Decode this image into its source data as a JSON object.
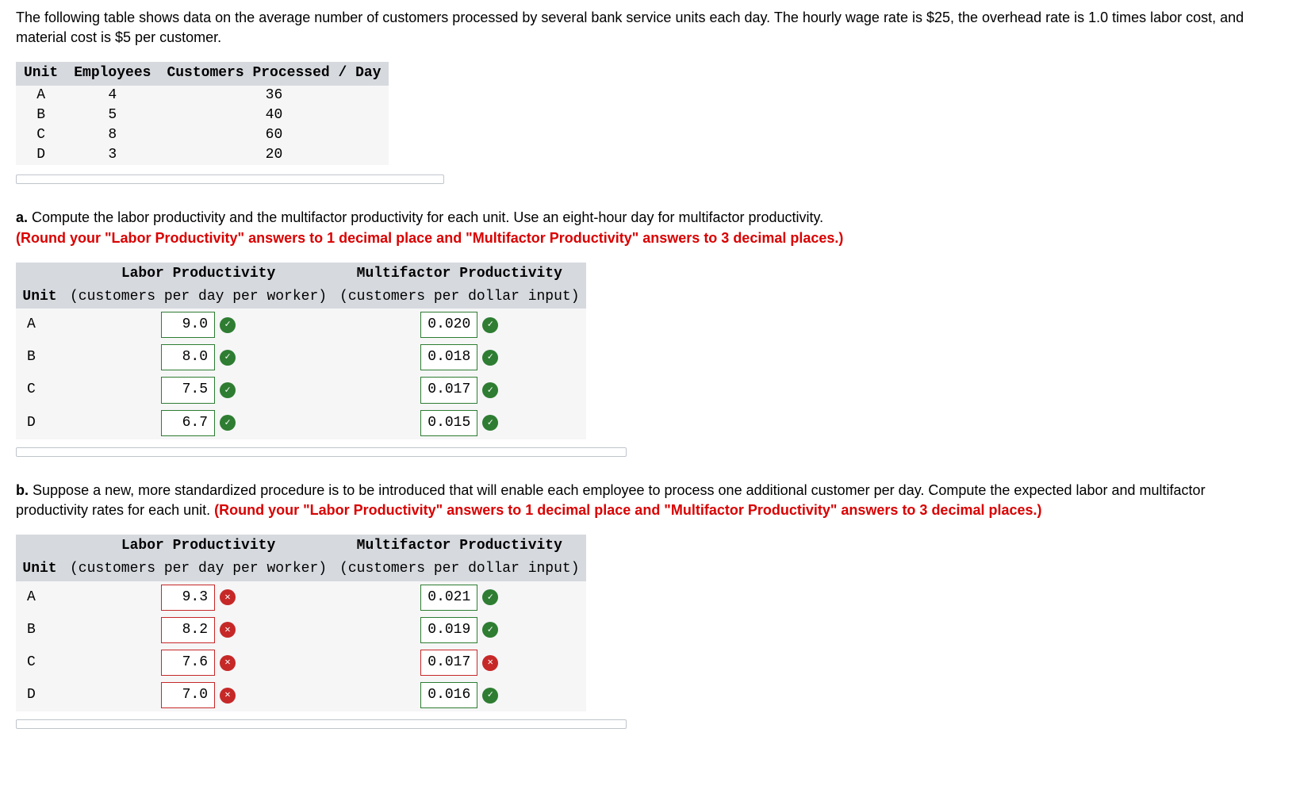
{
  "intro": "The following table shows data on the average number of customers processed by several bank service units each day. The hourly wage rate is $25, the overhead rate is 1.0 times labor cost, and material cost is $5 per customer.",
  "data_table": {
    "headers": [
      "Unit",
      "Employees",
      "Customers Processed / Day"
    ],
    "rows": [
      {
        "unit": "A",
        "employees": "4",
        "customers": "36"
      },
      {
        "unit": "B",
        "employees": "5",
        "customers": "40"
      },
      {
        "unit": "C",
        "employees": "8",
        "customers": "60"
      },
      {
        "unit": "D",
        "employees": "3",
        "customers": "20"
      }
    ]
  },
  "question_a": {
    "prefix": "a.",
    "body": "Compute the labor productivity and the multifactor productivity for each unit. Use an eight-hour day for multifactor productivity.",
    "red": "(Round your \"Labor Productivity\" answers to 1 decimal place and \"Multifactor Productivity\" answers to 3 decimal places.)",
    "headers": {
      "unit": "Unit",
      "labor_top": "Labor Productivity",
      "labor_sub": "(customers per day per worker)",
      "multi_top": "Multifactor Productivity",
      "multi_sub": "(customers per dollar input)"
    },
    "rows": [
      {
        "unit": "A",
        "labor": "9.0",
        "labor_ok": true,
        "multi": "0.020",
        "multi_ok": true
      },
      {
        "unit": "B",
        "labor": "8.0",
        "labor_ok": true,
        "multi": "0.018",
        "multi_ok": true
      },
      {
        "unit": "C",
        "labor": "7.5",
        "labor_ok": true,
        "multi": "0.017",
        "multi_ok": true
      },
      {
        "unit": "D",
        "labor": "6.7",
        "labor_ok": true,
        "multi": "0.015",
        "multi_ok": true
      }
    ]
  },
  "question_b": {
    "prefix": "b.",
    "body_black": "Suppose a new, more standardized procedure is to be introduced that will enable each employee to process one additional customer per day. Compute the expected labor and multifactor productivity rates for each unit. ",
    "body_red": "(Round your \"Labor Productivity\" answers to 1 decimal place and \"Multifactor Productivity\" answers to 3 decimal places.)",
    "headers": {
      "unit": "Unit",
      "labor_top": "Labor Productivity",
      "labor_sub": "(customers per day per worker)",
      "multi_top": "Multifactor Productivity",
      "multi_sub": "(customers per dollar input)"
    },
    "rows": [
      {
        "unit": "A",
        "labor": "9.3",
        "labor_ok": false,
        "multi": "0.021",
        "multi_ok": true
      },
      {
        "unit": "B",
        "labor": "8.2",
        "labor_ok": false,
        "multi": "0.019",
        "multi_ok": true
      },
      {
        "unit": "C",
        "labor": "7.6",
        "labor_ok": false,
        "multi": "0.017",
        "multi_ok": false
      },
      {
        "unit": "D",
        "labor": "7.0",
        "labor_ok": false,
        "multi": "0.016",
        "multi_ok": true
      }
    ]
  }
}
